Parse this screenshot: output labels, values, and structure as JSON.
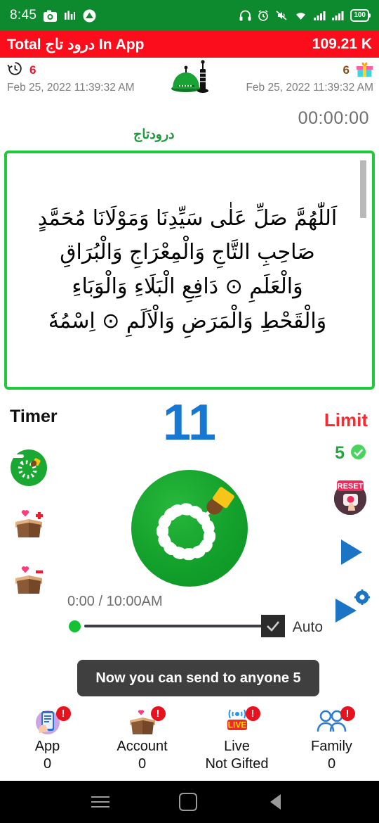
{
  "status_bar": {
    "time": "8:45",
    "battery_text": "100",
    "icons": [
      "camera-icon",
      "stats-icon",
      "app-logo-icon",
      "headphones-icon",
      "alarm-icon",
      "mute-icon",
      "wifi-icon",
      "signal-icon",
      "signal-icon-2",
      "battery-icon"
    ],
    "background_color": "#0e8a2e"
  },
  "banner": {
    "title": "Total درود تاج In App",
    "total_value": "109.21 K",
    "background_color": "#fb0d1b"
  },
  "info_row": {
    "left": {
      "count": "6",
      "timestamp": "Feb 25, 2022 11:39:32 AM",
      "icon": "history-icon"
    },
    "right": {
      "count": "6",
      "timestamp": "Feb 25, 2022 11:39:32 AM",
      "icon": "gift-icon"
    },
    "center_icon": "mosque-icon",
    "elapsed_time": "00:00:00",
    "durood_label": "درودتاج"
  },
  "arabic_text": {
    "lines": [
      "اَللّٰهُمَّ صَلِّ عَلٰى سَيِّدِنَا وَمَوْلَانَا مُحَمَّدٍ",
      "صَاحِبِ التَّاجِ وَالْمِعْرَاجِ وَالْبُرَاقِ",
      "وَالْعَلَمِ ⊙ دَافِعِ الْبَلَاءِ وَالْوَبَاءِ",
      "وَالْقَحْطِ وَالْمَرَضِ وَالْاَلَمِ ⊙ اِسْمُهٗ"
    ],
    "border_color": "#22c83c"
  },
  "counter_panel": {
    "timer_label": "Timer",
    "count": "11",
    "count_color": "#1778d4",
    "limit_label": "Limit",
    "limit_label_color": "#fb2a30",
    "limit_value": "5",
    "limit_value_color": "#22a73c",
    "limit_check_icon": "check-circle-icon"
  },
  "controls": {
    "left_icons": [
      {
        "name": "tasbih-minus-icon"
      },
      {
        "name": "box-heart-plus-icon"
      },
      {
        "name": "box-heart-minus-icon"
      }
    ],
    "right_icons": [
      {
        "name": "reset-icon"
      },
      {
        "name": "play-icon"
      },
      {
        "name": "play-settings-icon"
      }
    ],
    "main_button_icon": "tasbih-beads-icon",
    "time_display": "0:00  /  10:00AM",
    "auto_label": "Auto",
    "auto_checked": true
  },
  "toast": {
    "message": "Now you can send to anyone 5"
  },
  "bottom_nav": [
    {
      "icon": "phone-app-icon",
      "label": "App",
      "sub": "0",
      "badge": "!"
    },
    {
      "icon": "box-heart-icon",
      "label": "Account",
      "sub": "0",
      "badge": "!"
    },
    {
      "icon": "live-icon",
      "label": "Live",
      "sub": "Not Gifted",
      "badge": "!"
    },
    {
      "icon": "family-icon",
      "label": "Family",
      "sub": "0",
      "badge": "!"
    }
  ],
  "android_nav": {
    "recents": "recents-icon",
    "home": "home-icon",
    "back": "back-icon"
  }
}
